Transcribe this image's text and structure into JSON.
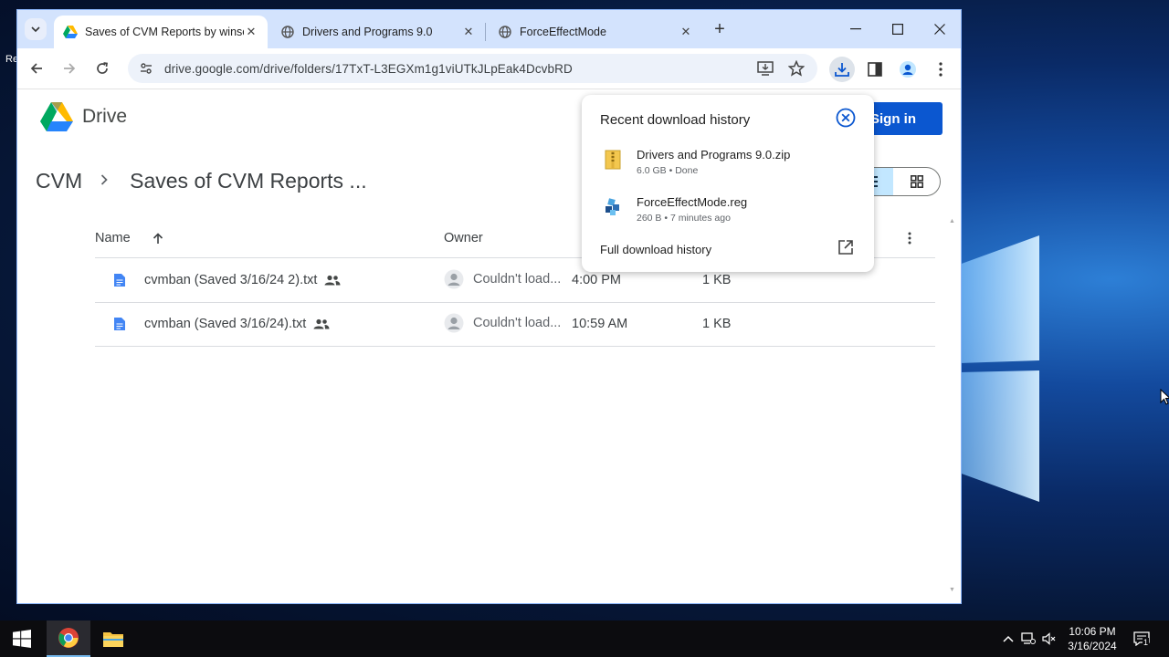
{
  "desktop": {
    "fragment_1": "Re"
  },
  "browser": {
    "tabs": [
      {
        "title": "Saves of CVM Reports by winse",
        "favicon": "google-drive-icon",
        "active": true
      },
      {
        "title": "Drivers and Programs 9.0",
        "favicon": "globe-icon",
        "active": false
      },
      {
        "title": "ForceEffectMode",
        "favicon": "globe-icon",
        "active": false
      }
    ],
    "new_tab_label": "+",
    "url": "drive.google.com/drive/folders/17TxT-L3EGXm1g1viUTkJLpEak4DcvbRD"
  },
  "drive": {
    "brand": "Drive",
    "sign_in": "Sign in",
    "breadcrumb": [
      "CVM",
      "Saves of CVM Reports ..."
    ],
    "columns": {
      "name": "Name",
      "owner": "Owner"
    },
    "rows": [
      {
        "name": "cvmban (Saved 3/16/24 2).txt",
        "owner": "Couldn't load...",
        "modified": "4:00 PM",
        "size": "1 KB"
      },
      {
        "name": "cvmban (Saved 3/16/24).txt",
        "owner": "Couldn't load...",
        "modified": "10:59 AM",
        "size": "1 KB"
      }
    ]
  },
  "downloads": {
    "title": "Recent download history",
    "items": [
      {
        "name": "Drivers and Programs 9.0.zip",
        "meta": "6.0 GB • Done",
        "icon": "zip-file-icon"
      },
      {
        "name": "ForceEffectMode.reg",
        "meta": "260 B • 7 minutes ago",
        "icon": "registry-file-icon"
      }
    ],
    "full_history": "Full download history"
  },
  "taskbar": {
    "time": "10:06 PM",
    "date": "3/16/2024",
    "notification_count": "1"
  },
  "colors": {
    "accent": "#0b57d0",
    "tabbar": "#d3e3fd",
    "omnibox": "#edf2fa",
    "view_toggle_active": "#c2e7ff"
  }
}
